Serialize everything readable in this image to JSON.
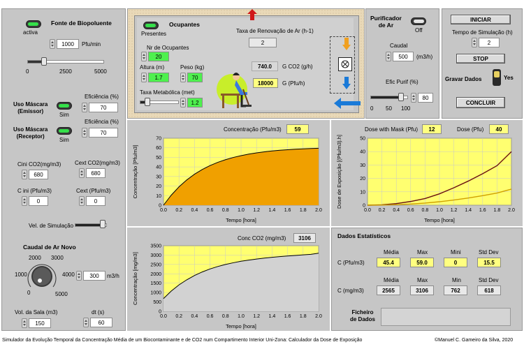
{
  "left": {
    "fonte_title": "Fonte de Biopoluente",
    "fonte_state": "activa",
    "fonte_value": "1000",
    "fonte_unit": "Pfu/min",
    "fonte_scale": [
      "0",
      "2500",
      "5000"
    ],
    "fonte_level": 0.2,
    "mask_emissor_title": "Uso Máscara\n(Emissor)",
    "mask_emissor_state": "Sim",
    "mask_emissor_eff_label": "Eficiência (%)",
    "mask_emissor_eff": "70",
    "mask_receptor_title": "Uso Máscara\n(Receptor)",
    "mask_receptor_state": "Sim",
    "mask_receptor_eff_label": "Eficiência (%)",
    "mask_receptor_eff": "70",
    "cini_co2_label": "Cini CO2(mg/m3)",
    "cini_co2": "680",
    "cext_co2_label": "Cext CO2(mg/m3)",
    "cext_co2": "680",
    "cini_pfu_label": "C ini (Pfu/m3)",
    "cini_pfu": "0",
    "cext_pfu_label": "Cext (Pfu/m3)",
    "cext_pfu": "0",
    "vel_label": "Vel. de Simulação",
    "caudal_title": "Caudal de  Ar Novo",
    "dial_labels": [
      "2000",
      "3000",
      "1000",
      "4000",
      "0",
      "5000"
    ],
    "caudal_value": "300",
    "caudal_unit": "m3/h",
    "vol_label": "Vol. da Sala (m3)",
    "vol_value": "150",
    "dt_label": "dt (s)",
    "dt_value": "60"
  },
  "occupants": {
    "title": "Ocupantes",
    "state": "Presentes",
    "nr_label": "Nr de Ocupantes",
    "nr_value": "20",
    "altura_label": "Altura (m)",
    "altura_value": "1.7",
    "peso_label": "Peso (kg)",
    "peso_value": "70",
    "taxa_met_label": "Taxa Metabólica (met)",
    "taxa_met_value": "1.2",
    "taxa_ren_label": "Taxa de Renovação de Ar (h-1)",
    "taxa_ren_value": "2",
    "gco2_value": "740.0",
    "gco2_label": "G CO2 (g/h)",
    "gpfu_value": "18000",
    "gpfu_label": "G (Pfu/h)"
  },
  "purifier": {
    "title": "Purificador\nde Ar",
    "state": "Off",
    "caudal_label": "Caudal",
    "caudal_value": "500",
    "caudal_unit": "(m3/h)",
    "efic_label": "Efic Purif (%)",
    "efic_value": "80",
    "efic_scale": [
      "0",
      "50",
      "100"
    ]
  },
  "controls": {
    "start_label": "INICIAR",
    "tempo_label": "Tempo de Simulação (h)",
    "tempo_value": "2",
    "stop_label": "STOP",
    "gravar_label": "Gravar Dados",
    "gravar_state": "Yes",
    "concluir_label": "CONCLUIR"
  },
  "charts_text": {
    "conc_label": "Concentração (Pfu/m3)",
    "conc_value": "59",
    "co2_label": "Conc CO2 (mg/m3)",
    "co2_value": "3106",
    "dose_mask_label": "Dose with Mask (Pfu)",
    "dose_mask_value": "12",
    "dose_label": "Dose (Pfu)",
    "dose_value": "40"
  },
  "stats": {
    "title": "Dados Estatísticos",
    "headers1": [
      "Média",
      "Max",
      "Mini",
      "Std Dev"
    ],
    "row1_label": "C (Pfu/m3)",
    "row1": [
      "45.4",
      "59.0",
      "0",
      "15.5"
    ],
    "headers2": [
      "Média",
      "Max",
      "Min",
      "Std Dev"
    ],
    "row2_label": "C (mg/m3)",
    "row2": [
      "2565",
      "3106",
      "762",
      "618"
    ],
    "ficheiro_label": "Ficheiro\nde Dados"
  },
  "footer": {
    "left": "Simulador da Evolução Temporal da Concentração Média de um Biocontaminante e de CO2 num Compartimento Interior Uni-Zona: Calculador da Dose de Exposição",
    "right": "©Manuel C. Gameiro da Silva, 2020"
  },
  "chart_data": [
    {
      "type": "area",
      "name": "conc-pfu",
      "xlabel": "Tempo  [hora]",
      "ylabel": "Concentração  [Pfu/m3]",
      "xlim": [
        0,
        2
      ],
      "ylim": [
        0,
        70
      ],
      "xticks": [
        "0.0",
        "0.2",
        "0.4",
        "0.6",
        "0.8",
        "1.0",
        "1.2",
        "1.4",
        "1.6",
        "1.8",
        "2.0"
      ],
      "yticks": [
        "0",
        "10",
        "20",
        "30",
        "40",
        "50",
        "60",
        "70"
      ],
      "fill": "#f0a000",
      "x": [
        0,
        0.1,
        0.2,
        0.3,
        0.4,
        0.5,
        0.6,
        0.7,
        0.8,
        0.9,
        1.0,
        1.1,
        1.2,
        1.3,
        1.4,
        1.5,
        1.6,
        1.7,
        1.8,
        1.9,
        2.0
      ],
      "y": [
        0,
        10.5,
        19.2,
        26.4,
        32.4,
        37.3,
        41.4,
        44.8,
        47.6,
        49.9,
        51.8,
        53.4,
        54.7,
        55.8,
        56.7,
        57.4,
        58.0,
        58.5,
        58.9,
        59.2,
        59.5
      ]
    },
    {
      "type": "area",
      "name": "conc-co2",
      "xlabel": "Tempo  [hora]",
      "ylabel": "Concentração  [mg/m3]",
      "xlim": [
        0,
        2
      ],
      "ylim": [
        0,
        3500
      ],
      "xticks": [
        "0.0",
        "0.2",
        "0.4",
        "0.6",
        "0.8",
        "1.0",
        "1.2",
        "1.4",
        "1.6",
        "1.8",
        "2.0"
      ],
      "yticks": [
        "0",
        "500",
        "1000",
        "1500",
        "2000",
        "2500",
        "3000",
        "3500"
      ],
      "fill": "#d2d2d2",
      "x": [
        0,
        0.1,
        0.2,
        0.3,
        0.4,
        0.5,
        0.6,
        0.7,
        0.8,
        0.9,
        1.0,
        1.1,
        1.2,
        1.3,
        1.4,
        1.5,
        1.6,
        1.7,
        1.8,
        1.9,
        2.0
      ],
      "y": [
        680,
        1080,
        1410,
        1680,
        1910,
        2100,
        2260,
        2390,
        2500,
        2590,
        2670,
        2730,
        2790,
        2840,
        2880,
        2920,
        2950,
        2980,
        3010,
        3040,
        3100
      ]
    },
    {
      "type": "line",
      "name": "dose",
      "xlabel": "Tempo  [hora]",
      "ylabel": "Dose de Exposição  [(Pfu/m3).h]",
      "xlim": [
        0,
        2
      ],
      "ylim": [
        0,
        50
      ],
      "xticks": [
        "0.0",
        "0.2",
        "0.4",
        "0.6",
        "0.8",
        "1.0",
        "1.2",
        "1.4",
        "1.6",
        "1.8",
        "2.0"
      ],
      "yticks": [
        "0",
        "10",
        "20",
        "30",
        "40",
        "50"
      ],
      "series": [
        {
          "color": "#6a1010",
          "x": [
            0,
            0.2,
            0.4,
            0.6,
            0.8,
            1.0,
            1.2,
            1.4,
            1.6,
            1.8,
            2.0
          ],
          "y": [
            0,
            0.3,
            1.2,
            2.8,
            5.0,
            8.5,
            13.0,
            18.0,
            23.5,
            29.5,
            40.0
          ]
        },
        {
          "color": "#d0a000",
          "x": [
            0,
            0.2,
            0.4,
            0.6,
            0.8,
            1.0,
            1.2,
            1.4,
            1.6,
            1.8,
            2.0
          ],
          "y": [
            0,
            0.1,
            0.4,
            0.9,
            1.6,
            2.6,
            3.9,
            5.4,
            7.1,
            9.1,
            12.0
          ]
        }
      ]
    }
  ]
}
